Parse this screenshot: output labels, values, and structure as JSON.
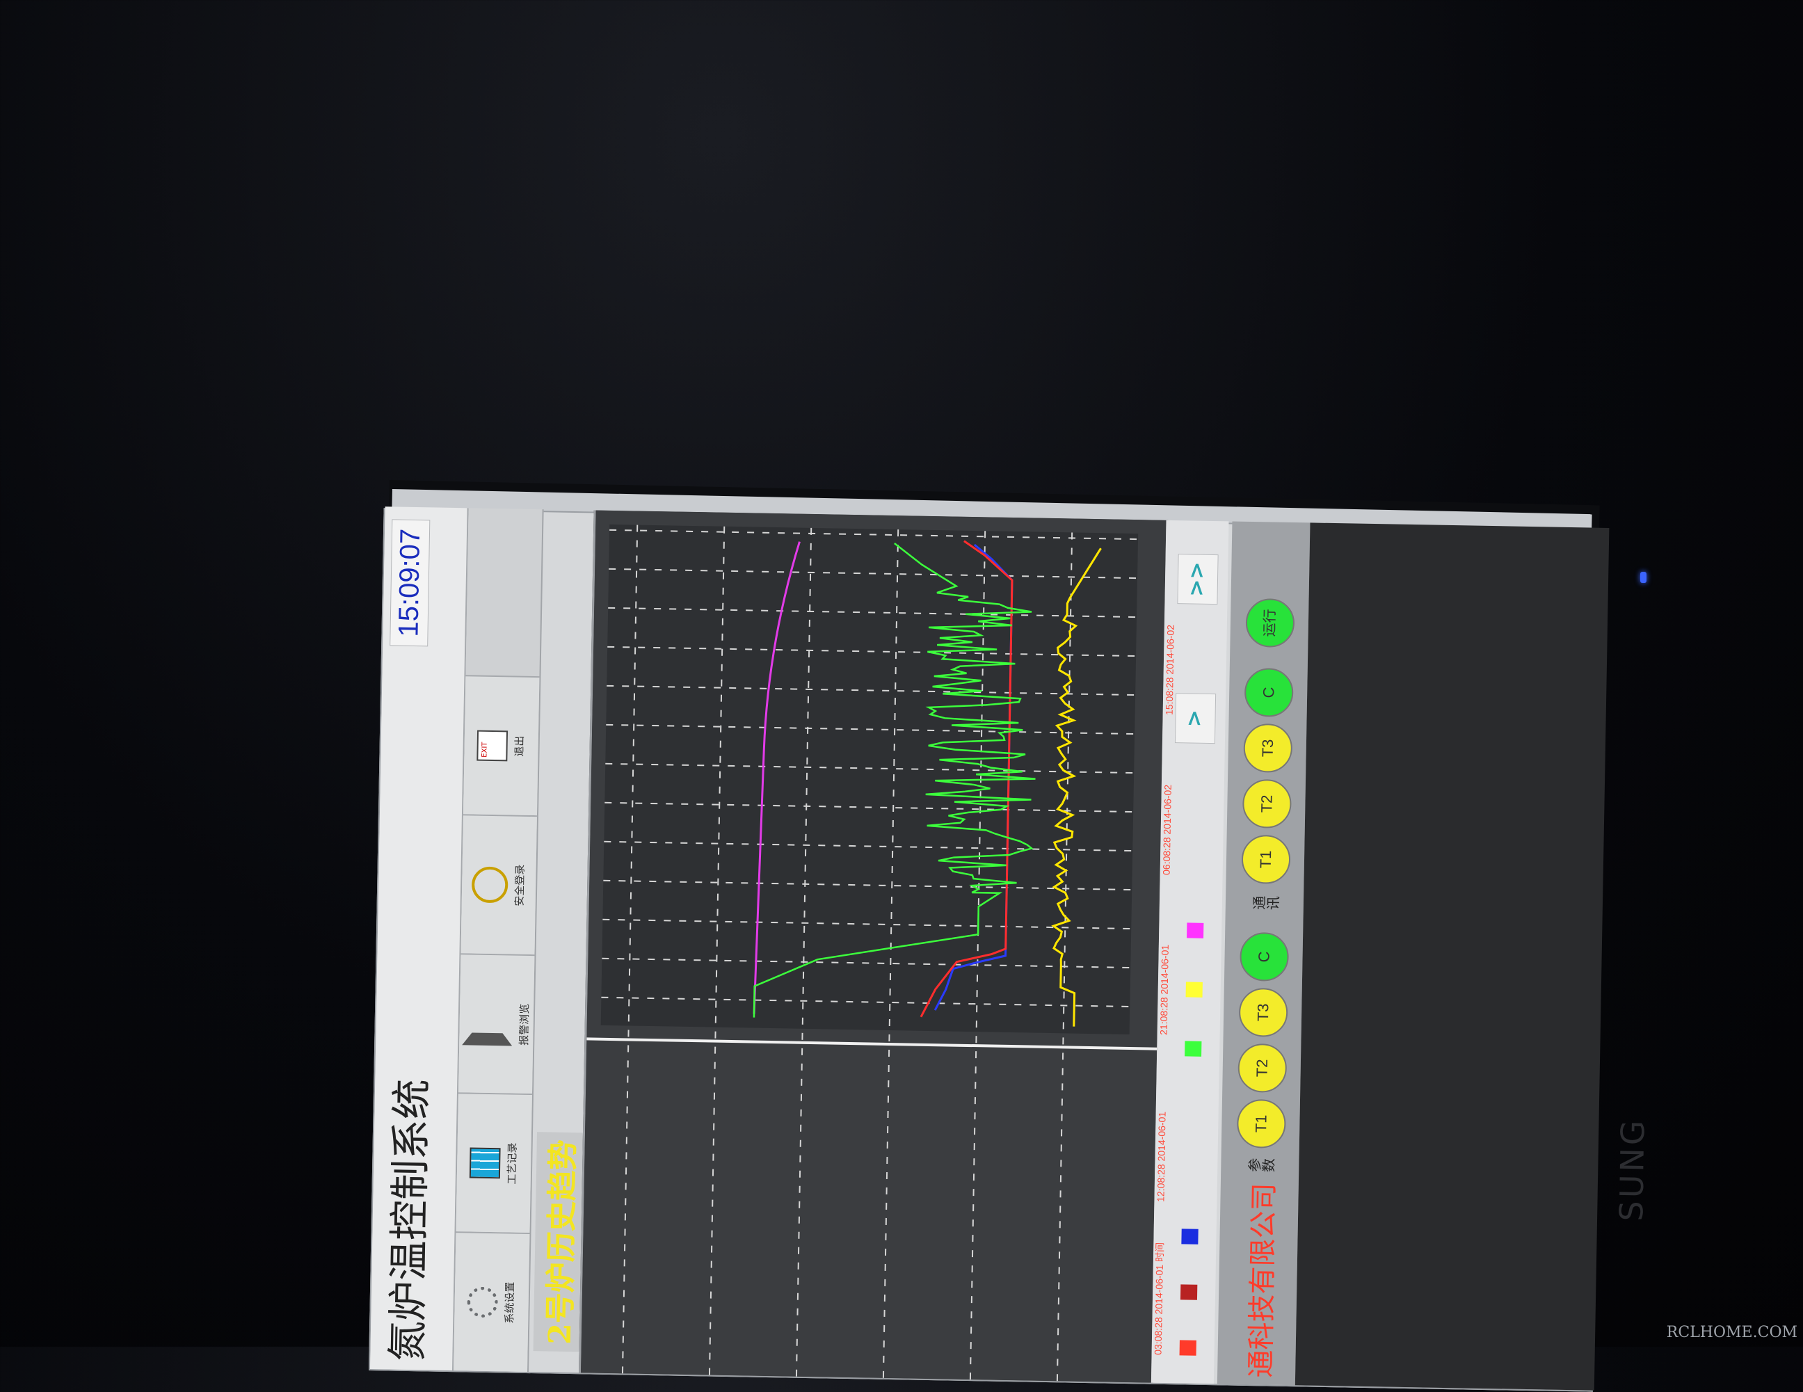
{
  "app": {
    "title": "氮炉温控制系统",
    "clock": "15:09:07"
  },
  "toolbar": {
    "items": [
      {
        "label": "系统设置",
        "icon": "gear-icon"
      },
      {
        "label": "工艺记录",
        "icon": "table-icon"
      },
      {
        "label": "报警浏览",
        "icon": "speaker-icon"
      },
      {
        "label": "安全登录",
        "icon": "key-icon"
      },
      {
        "label": "退出",
        "icon": "exit-icon"
      }
    ]
  },
  "page": {
    "title": "2号炉历史趋势"
  },
  "chart": {
    "time_labels": [
      {
        "time": "03:08:28",
        "date": "2014-06-01",
        "suffix": "时间"
      },
      {
        "time": "12:08:28",
        "date": "2014-06-01"
      },
      {
        "time": "21:08:28",
        "date": "2014-06-01"
      },
      {
        "time": "06:08:28",
        "date": "2014-06-02"
      },
      {
        "time": "15:08:28",
        "date": "2014-06-02"
      }
    ],
    "legend_colors": [
      "#ff3b2a",
      "#b82222",
      "#1a2de0",
      "#3cff3c",
      "#ffff33",
      "#ff33ff"
    ],
    "scroll_buttons": [
      ">",
      ">>"
    ]
  },
  "status": {
    "company": "通科技有限公司",
    "group1_label": "参数",
    "group1": [
      "T1",
      "T2",
      "T3",
      "C"
    ],
    "group2_label": "通讯",
    "group2": [
      "T1",
      "T2",
      "T3",
      "C"
    ],
    "run_label": "运行"
  },
  "photo": {
    "brand": "SUNG",
    "watermark": "RCLHOME.COM"
  }
}
